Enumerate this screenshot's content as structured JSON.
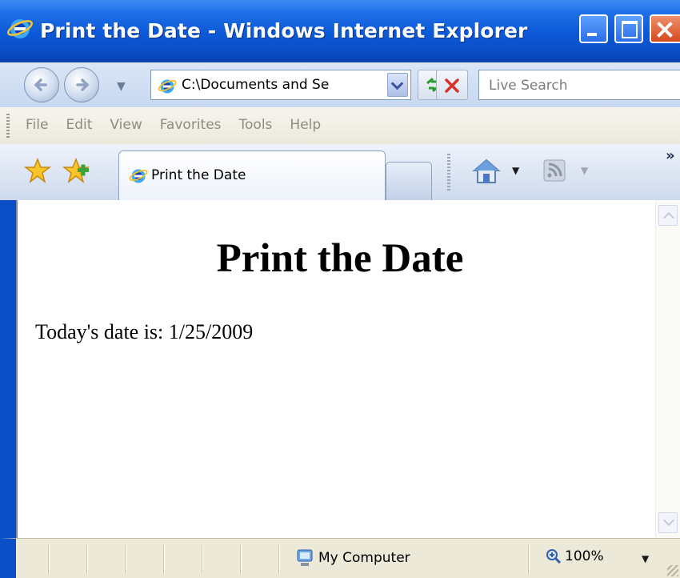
{
  "window": {
    "title": "Print the Date - Windows Internet Explorer"
  },
  "toolbar": {
    "address": "C:\\Documents and Se",
    "search_placeholder": "Live Search"
  },
  "menu": [
    "File",
    "Edit",
    "View",
    "Favorites",
    "Tools",
    "Help"
  ],
  "tabs": [
    {
      "label": "Print the Date",
      "active": true
    }
  ],
  "page": {
    "heading": "Print the Date",
    "text": "Today's date is: 1/25/2009"
  },
  "status": {
    "zone": "My Computer",
    "zoom": "100%"
  },
  "colors": {
    "titlebar": "#0a4fc8",
    "accent": "#1f6fe6"
  }
}
